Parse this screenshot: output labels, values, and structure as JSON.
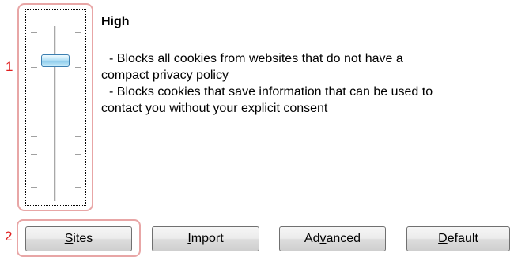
{
  "privacy": {
    "level_title": "High",
    "description": [
      "- Blocks all cookies from websites that do not have a",
      "compact privacy policy",
      "- Blocks cookies that save information that can be used to",
      "contact you without your explicit consent"
    ],
    "slider_level": "High",
    "slider_positions": 6,
    "slider_selected_index": 1
  },
  "annotations": {
    "label_1": "1",
    "label_2": "2",
    "highlight_color": "#e8a6a6",
    "label_color": "#e02020"
  },
  "buttons": {
    "sites": {
      "label_mnemonic": "S",
      "label_rest": "ites"
    },
    "import": {
      "label_mnemonic": "I",
      "label_rest": "mport"
    },
    "advanced": {
      "label_pre": "Ad",
      "label_mnemonic": "v",
      "label_rest": "anced"
    },
    "default": {
      "label_mnemonic": "D",
      "label_rest": "efault"
    }
  },
  "colors": {
    "thumb_border": "#3c7fb1",
    "thumb_fill": "#b6e2f7",
    "button_border": "#707070"
  }
}
